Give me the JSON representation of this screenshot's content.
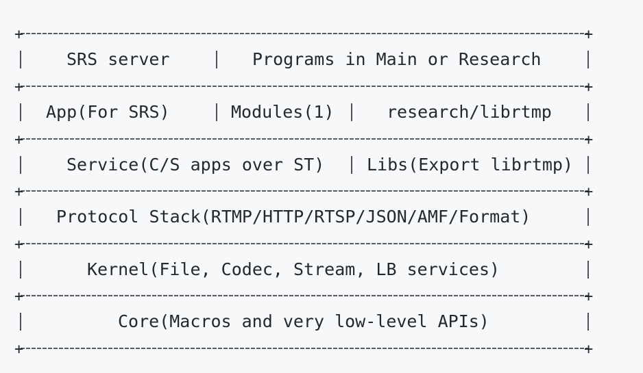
{
  "diagram": {
    "rows": [
      {
        "cells": [
          "SRS server",
          "Programs in Main or Research"
        ]
      },
      {
        "cells": [
          "App(For SRS)",
          "Modules(1)",
          "research/librtmp"
        ]
      },
      {
        "cells": [
          "Service(C/S apps over ST)",
          "Libs(Export librtmp)"
        ]
      },
      {
        "cells": [
          "Protocol Stack(RTMP/HTTP/RTSP/JSON/AMF/Format)"
        ]
      },
      {
        "cells": [
          "Kernel(File, Codec, Stream, LB services)"
        ]
      },
      {
        "cells": [
          "Core(Macros and very low-level APIs)"
        ]
      }
    ]
  }
}
